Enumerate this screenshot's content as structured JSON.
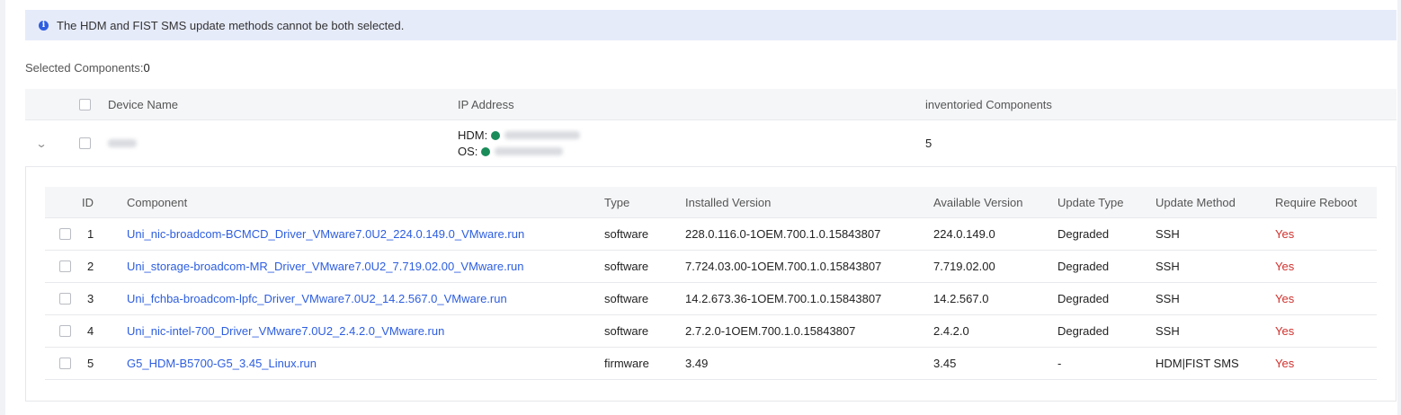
{
  "alert": {
    "icon": "info-icon",
    "text": "The HDM and FIST SMS update methods cannot be both selected."
  },
  "selection": {
    "label": "Selected Components:",
    "count": "0"
  },
  "outer_table": {
    "columns": {
      "device_name": "Device Name",
      "ip_address": "IP Address",
      "inventoried": "inventoried Components"
    },
    "row": {
      "hdm_label": "HDM:",
      "os_label": "OS:",
      "status_color": "#1a8c5a",
      "components": "5"
    }
  },
  "inner_table": {
    "columns": {
      "id": "ID",
      "component": "Component",
      "type": "Type",
      "installed": "Installed Version",
      "available": "Available Version",
      "update_type": "Update Type",
      "update_method": "Update Method",
      "reboot": "Require Reboot"
    },
    "rows": [
      {
        "id": "1",
        "component": "Uni_nic-broadcom-BCMCD_Driver_VMware7.0U2_224.0.149.0_VMware.run",
        "type": "software",
        "installed": "228.0.116.0-1OEM.700.1.0.15843807",
        "available": "224.0.149.0",
        "update_type": "Degraded",
        "update_method": "SSH",
        "reboot": "Yes"
      },
      {
        "id": "2",
        "component": "Uni_storage-broadcom-MR_Driver_VMware7.0U2_7.719.02.00_VMware.run",
        "type": "software",
        "installed": "7.724.03.00-1OEM.700.1.0.15843807",
        "available": "7.719.02.00",
        "update_type": "Degraded",
        "update_method": "SSH",
        "reboot": "Yes"
      },
      {
        "id": "3",
        "component": "Uni_fchba-broadcom-lpfc_Driver_VMware7.0U2_14.2.567.0_VMware.run",
        "type": "software",
        "installed": "14.2.673.36-1OEM.700.1.0.15843807",
        "available": "14.2.567.0",
        "update_type": "Degraded",
        "update_method": "SSH",
        "reboot": "Yes"
      },
      {
        "id": "4",
        "component": "Uni_nic-intel-700_Driver_VMware7.0U2_2.4.2.0_VMware.run",
        "type": "software",
        "installed": "2.7.2.0-1OEM.700.1.0.15843807",
        "available": "2.4.2.0",
        "update_type": "Degraded",
        "update_method": "SSH",
        "reboot": "Yes"
      },
      {
        "id": "5",
        "component": "G5_HDM-B5700-G5_3.45_Linux.run",
        "type": "firmware",
        "installed": "3.49",
        "available": "3.45",
        "update_type": "-",
        "update_method": "HDM|FIST SMS",
        "reboot": "Yes"
      }
    ]
  },
  "colors": {
    "link": "#2d5ee0",
    "reboot_yes": "#d0312d",
    "alert_bg": "#e6ebfa",
    "header_bg": "#f5f6f8"
  }
}
